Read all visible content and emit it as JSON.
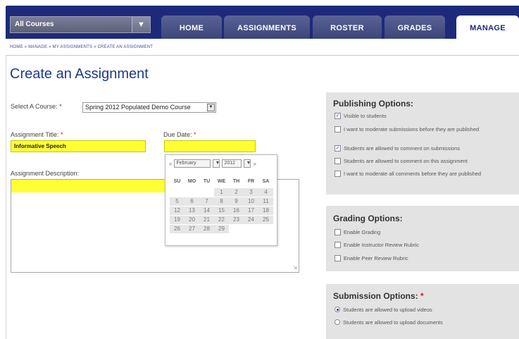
{
  "nav": {
    "course_selector": "All Courses",
    "tabs": [
      "HOME",
      "ASSIGNMENTS",
      "ROSTER",
      "GRADES",
      "MANAGE"
    ],
    "active_tab": "MANAGE"
  },
  "breadcrumb": "HOME » MANAGE » MY ASSIGNMENTS » CREATE AN ASSIGNMENT",
  "page_title": "Create an Assignment",
  "form": {
    "select_course_label": "Select A Course:",
    "required_mark": "*",
    "course_value": "Spring 2012 Populated Demo Course",
    "title_label": "Assignment Title:",
    "title_value": "Informative Speech",
    "due_label": "Due Date:",
    "due_value": "",
    "desc_label": "Assignment Description:"
  },
  "calendar": {
    "month": "February",
    "year": "2012",
    "prev": "«",
    "next": "»",
    "weekdays": [
      "SU",
      "MO",
      "TU",
      "WE",
      "TH",
      "FR",
      "SA"
    ],
    "weeks": [
      [
        "",
        "",
        "",
        "1",
        "2",
        "3",
        "4"
      ],
      [
        "5",
        "6",
        "7",
        "8",
        "9",
        "10",
        "11"
      ],
      [
        "12",
        "13",
        "14",
        "15",
        "16",
        "17",
        "18"
      ],
      [
        "19",
        "20",
        "21",
        "22",
        "23",
        "24",
        "25"
      ],
      [
        "26",
        "27",
        "28",
        "29",
        "",
        "",
        ""
      ]
    ]
  },
  "publishing": {
    "title": "Publishing Options:",
    "options": [
      {
        "label": "Visible to students",
        "checked": true
      },
      {
        "label": "I want to moderate submissions before they are published",
        "checked": false
      },
      {
        "label": "Students are allowed to comment on submissions",
        "checked": true
      },
      {
        "label": "Students are allowed to comment on this assignment",
        "checked": false
      },
      {
        "label": "I want to moderate all comments before they are published",
        "checked": false
      }
    ]
  },
  "grading": {
    "title": "Grading Options:",
    "options": [
      {
        "label": "Enable Grading",
        "checked": false
      },
      {
        "label": "Enable Instructor Review Rubric",
        "checked": false
      },
      {
        "label": "Enable Peer Review Rubric",
        "checked": false
      }
    ]
  },
  "submission": {
    "title": "Submission Options:",
    "required_mark": "*",
    "options": [
      {
        "label": "Students are allowed to upload videos",
        "selected": true
      },
      {
        "label": "Students are allowed to upload documents",
        "selected": false
      }
    ]
  },
  "icons": {
    "dropdown": "chevron-down-icon",
    "checkmark": "checkmark-icon",
    "resize": "resize-grip-icon"
  },
  "colors": {
    "nav_bg": "#1d2a7a",
    "tab_bg": "#4a5388",
    "title": "#1d3a8a",
    "input_highlight": "#ffff33",
    "panel_bg": "#e3e3e3",
    "required": "#cc2222"
  }
}
